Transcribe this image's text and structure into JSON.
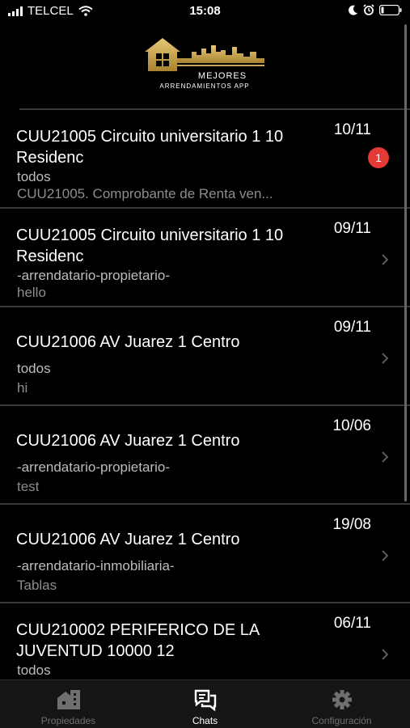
{
  "status": {
    "carrier": "TELCEL",
    "time": "15:08"
  },
  "logo": {
    "title": "MEJORES",
    "subtitle": "ARRENDAMIENTOS APP"
  },
  "chats": [
    {
      "title": "CUU21005 Circuito universitario 1 10 Residenc",
      "date": "10/11",
      "role": "todos",
      "preview": "CUU21005. Comprobante de Renta ven...",
      "badge": "1"
    },
    {
      "title": "CUU21005 Circuito universitario 1 10 Residenc",
      "date": "09/11",
      "role": "-arrendatario-propietario-",
      "preview": "hello"
    },
    {
      "title": "CUU21006 AV Juarez 1  Centro",
      "date": "09/11",
      "role": "todos",
      "preview": "hi"
    },
    {
      "title": "CUU21006 AV Juarez 1  Centro",
      "date": "10/06",
      "role": "-arrendatario-propietario-",
      "preview": "test"
    },
    {
      "title": "CUU21006 AV Juarez 1  Centro",
      "date": "19/08",
      "role": "-arrendatario-inmobiliaria-",
      "preview": "Tablas"
    },
    {
      "title": "CUU210002 PERIFERICO DE LA JUVENTUD 10000 12",
      "date": "06/11",
      "role": "todos",
      "preview": ""
    }
  ],
  "tabs": [
    {
      "label": "Propiedades",
      "icon": "buildings-icon",
      "active": false
    },
    {
      "label": "Chats",
      "icon": "chat-bubbles-icon",
      "active": true
    },
    {
      "label": "Configuración",
      "icon": "gear-icon",
      "active": false
    }
  ],
  "colors": {
    "background": "#000000",
    "badge": "#e53935",
    "logo_gold": "#c9a54a"
  }
}
